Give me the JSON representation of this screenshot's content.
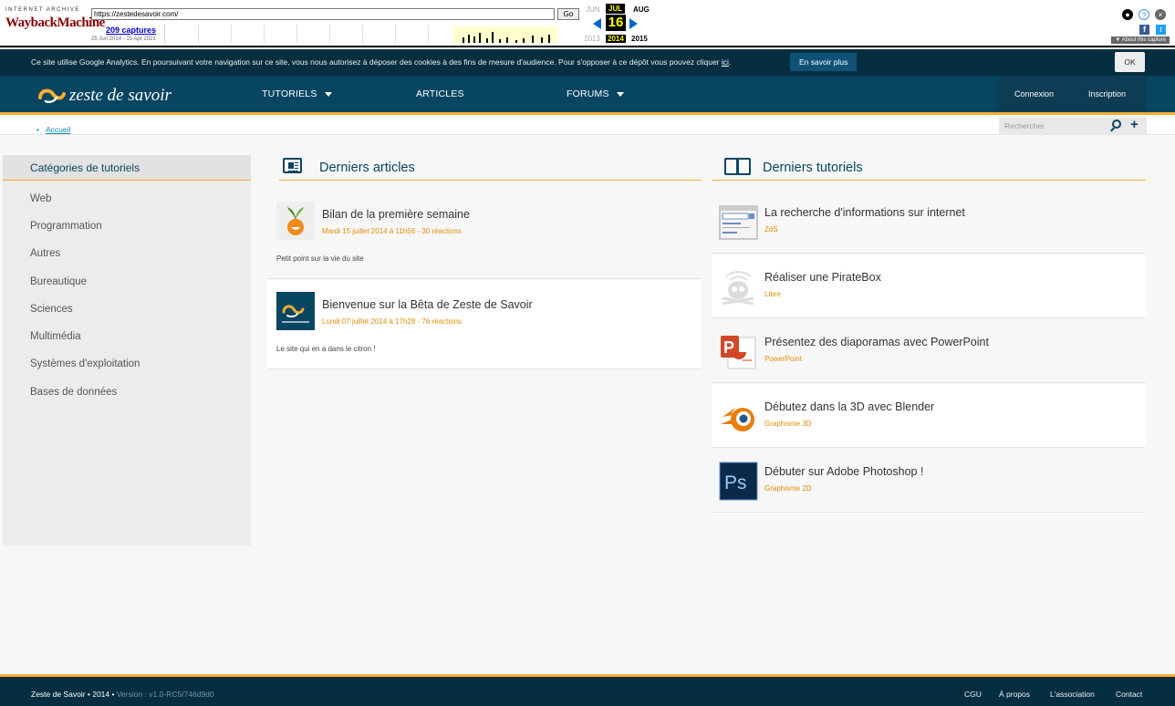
{
  "wayback": {
    "logo_top": "INTERNET ARCHIVE",
    "logo_main": "WaybackMachine",
    "url": "https://zestedesavoir.com/",
    "go": "Go",
    "captures": "209 captures",
    "range": "25 Jun 2014 - 15 Apr 2021",
    "months": {
      "prev": "JUN",
      "cur": "JUL",
      "next": "AUG"
    },
    "day": "16",
    "years": {
      "prev": "2013",
      "cur": "2014",
      "next": "2015"
    },
    "about": "▼ About this capture"
  },
  "cookie": {
    "text": "Ce site utilise Google Analytics. En poursuivant votre navigation sur ce site, vous nous autorisez à déposer des cookies à des fins de mesure d'audience. Pour s'opposer à ce dépôt vous pouvez cliquer ",
    "link": "ici",
    "more": "En savoir plus",
    "ok": "OK"
  },
  "header": {
    "logo": "zeste de savoir",
    "nav": [
      {
        "label": "TUTORIELS",
        "dropdown": true
      },
      {
        "label": "ARTICLES",
        "dropdown": false
      },
      {
        "label": "FORUMS",
        "dropdown": true
      }
    ],
    "login": "Connexion",
    "signup": "Inscription"
  },
  "breadcrumb": "Accueil",
  "search": {
    "placeholder": "Rechercher"
  },
  "sidebar": {
    "title": "Catégories de tutoriels",
    "items": [
      "Web",
      "Programmation",
      "Autres",
      "Bureautique",
      "Sciences",
      "Multimédia",
      "Systèmes d'exploitation",
      "Bases de données"
    ]
  },
  "articles": {
    "heading": "Derniers articles",
    "items": [
      {
        "title": "Bilan de la première semaine",
        "meta": "Mardi 15 juillet 2014 à 11h56 - 30 réactions",
        "desc": "Petit point sur la vie du site"
      },
      {
        "title": "Bienvenue sur la Bêta de Zeste de Savoir",
        "meta": "Lundi 07 juillet 2014 à 17h28 - 76 réactions",
        "desc": "Le site qui en a dans le citron !"
      }
    ]
  },
  "tutorials": {
    "heading": "Derniers tutoriels",
    "items": [
      {
        "title": "La recherche d'informations sur internet",
        "tag": "ZdS"
      },
      {
        "title": "Réaliser une PirateBox",
        "tag": "Libre"
      },
      {
        "title": "Présentez des diaporamas avec PowerPoint",
        "tag": "PowerPoint"
      },
      {
        "title": "Débutez dans la 3D avec Blender",
        "tag": "Graphisme 3D"
      },
      {
        "title": "Débuter sur Adobe Photoshop !",
        "tag": "Graphisme 2D"
      }
    ]
  },
  "footer": {
    "brand": "Zeste de Savoir • 2014 •",
    "version": " Version : v1.0-RC5/746d9d0",
    "links": [
      "CGU",
      "À propos",
      "L'association",
      "Contact"
    ]
  }
}
